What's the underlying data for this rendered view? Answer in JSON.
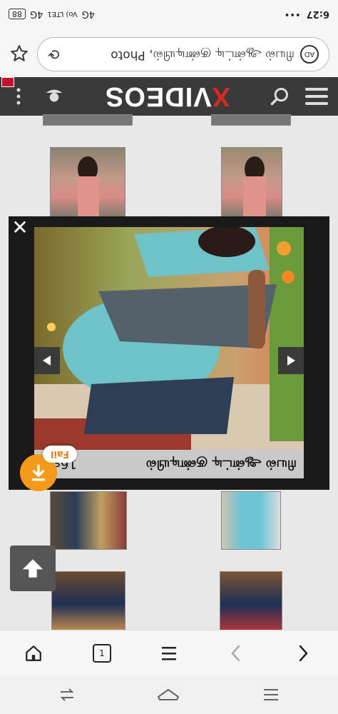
{
  "status_bar": {
    "time": "6:27",
    "battery": "88",
    "network": "4G",
    "network2": "4G",
    "volte": "Vo) LTE1",
    "dots": "•••"
  },
  "url_bar": {
    "url_text": "ரியல் ஆன்ட்டி குண்டியில், Photo",
    "ad_badge": "AD"
  },
  "site": {
    "logo_x": "X",
    "logo_rest": "VIDEOS"
  },
  "player": {
    "close": "✕",
    "caption": "ரியல் ஆன்ட்டி குண்டியில்",
    "duration": "16s/2"
  },
  "download": {
    "fail_label": "Fail"
  },
  "browser_nav": {
    "tab_count": "1"
  },
  "colors": {
    "brand_red": "#d42a1f",
    "header_bg": "#3a3a3a",
    "download_orange": "#f39a1a"
  }
}
